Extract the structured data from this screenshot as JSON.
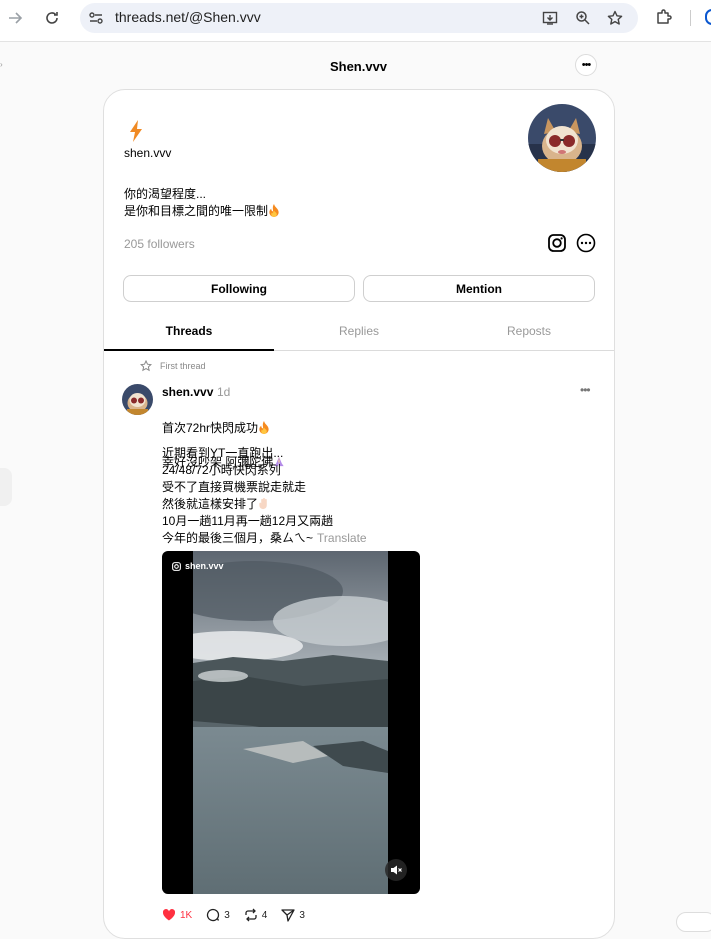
{
  "browser": {
    "url": "threads.net/@Shen.vvv"
  },
  "page": {
    "title": "Shen.vvv"
  },
  "profile": {
    "handle": "shen.vvv",
    "bio_line1": "你的渴望程度...",
    "bio_line2": "是你和目標之間的唯一限制",
    "followers": "205 followers",
    "following_label": "Following",
    "mention_label": "Mention"
  },
  "tabs": [
    {
      "label": "Threads",
      "active": true
    },
    {
      "label": "Replies",
      "active": false
    },
    {
      "label": "Reposts",
      "active": false
    }
  ],
  "post": {
    "pinned_label": "First thread",
    "username": "shen.vvv",
    "time": "1d",
    "line1": "首次72hr快閃成功",
    "line2": "幸好沒吵架 阿彌陀佛",
    "para2_lines": [
      "近期看到YT一直跑出...",
      "24/48/72小時快閃系列",
      "受不了直接買機票說走就走",
      "然後就這樣安排了",
      "10月一趟11月再一趟12月又兩趟",
      "今年的最後三個月，桑ㄙㄟ~"
    ],
    "translate_label": "Translate",
    "media_watermark": "shen.vvv",
    "likes": "1K",
    "replies": "3",
    "reposts": "4",
    "shares": "3"
  },
  "colors": {
    "accent_like": "#ff3040",
    "bolt": "#f08a24",
    "muted_text": "#999999"
  },
  "icons": [
    "back-arrow-icon",
    "reload-icon",
    "site-info-icon",
    "install-icon",
    "zoom-icon",
    "bookmark-star-icon",
    "extensions-icon",
    "bolt-icon",
    "instagram-icon",
    "more-icon",
    "pin-star-icon",
    "heart-icon",
    "comment-icon",
    "repost-icon",
    "share-icon",
    "mute-icon"
  ]
}
